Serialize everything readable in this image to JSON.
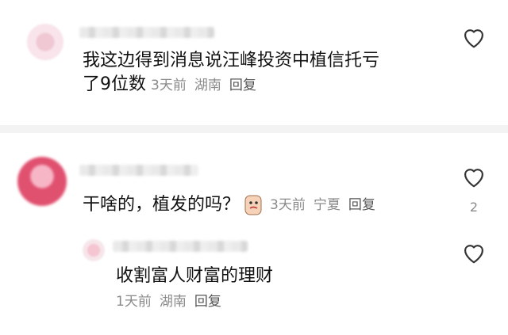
{
  "comments": [
    {
      "text": "我这边得到消息说汪峰投资中植信托亏",
      "text2": "了9位数",
      "time": "3天前",
      "location": "湖南",
      "reply": "回复"
    },
    {
      "text": "干啥的，植发的吗？",
      "time": "3天前",
      "location": "宁夏",
      "reply": "回复",
      "like_count": "2"
    },
    {
      "text": "收割富人财富的理财",
      "time": "1天前",
      "location": "湖南",
      "reply": "回复"
    }
  ],
  "icons": {
    "like": "heart-outline-icon",
    "emoji": "face-emoji-icon"
  }
}
